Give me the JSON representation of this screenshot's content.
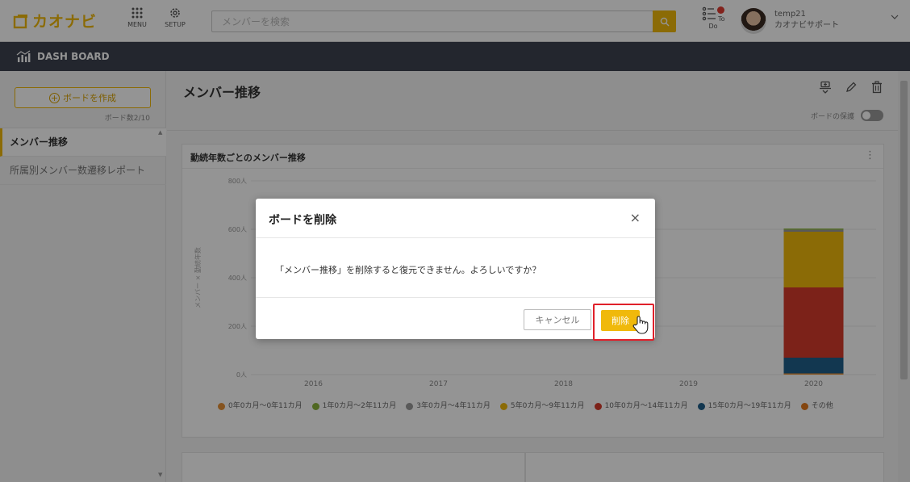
{
  "header": {
    "logo_text": "カオナビ",
    "menu_label": "MENU",
    "setup_label": "SETUP",
    "search_placeholder": "メンバーを検索",
    "todo_label": "To Do",
    "user_id": "temp21",
    "user_org": "カオナビサポート"
  },
  "dashbar": {
    "title": "DASH BOARD"
  },
  "sidebar": {
    "create_label": "ボードを作成",
    "board_count": "ボード数2/10",
    "items": [
      {
        "label": "メンバー推移",
        "active": true
      },
      {
        "label": "所属別メンバー数遷移レポート",
        "active": false
      }
    ]
  },
  "main": {
    "title": "メンバー推移",
    "protect_label": "ボードの保護",
    "card_title": "勤続年数ごとのメンバー推移"
  },
  "chart_data": {
    "type": "bar",
    "stacked": true,
    "categories": [
      "2016",
      "2017",
      "2018",
      "2019",
      "2020"
    ],
    "ylabel": "メンバー × 勤続年数",
    "ylim": [
      0,
      800
    ],
    "yticks": [
      "0人",
      "200人",
      "400人",
      "600人",
      "800人"
    ],
    "ytick_values": [
      0,
      200,
      400,
      600,
      800
    ],
    "series": [
      {
        "name": "0年0カ月〜0年11カ月",
        "color": "#e69138",
        "values": [
          0,
          0,
          0,
          0,
          5
        ]
      },
      {
        "name": "1年0カ月〜2年11カ月",
        "color": "#8bb33b",
        "values": [
          0,
          0,
          0,
          0,
          0
        ]
      },
      {
        "name": "3年0カ月〜4年11カ月",
        "color": "#999999",
        "values": [
          0,
          0,
          0,
          0,
          0
        ]
      },
      {
        "name": "5年0カ月〜9年11カ月",
        "color": "#f0b90b",
        "values": [
          0,
          0,
          0,
          0,
          0
        ]
      },
      {
        "name": "10年0カ月〜14年11カ月",
        "color": "#d63c2b",
        "values": [
          0,
          0,
          0,
          0,
          0
        ]
      },
      {
        "name": "15年0カ月〜19年11カ月",
        "color": "#1f5f8b",
        "values": [
          0,
          0,
          0,
          0,
          65
        ]
      },
      {
        "name": "その他",
        "color": "#e3791c",
        "values": [
          0,
          0,
          0,
          0,
          0
        ]
      }
    ],
    "segments_2020_top": [
      {
        "color": "#d63c2b",
        "value": 290
      },
      {
        "color": "#f0b90b",
        "value": 230
      },
      {
        "color": "#999999",
        "value": 8
      },
      {
        "color": "#8bb33b",
        "value": 5
      }
    ],
    "legend_position": "bottom"
  },
  "modal": {
    "title": "ボードを削除",
    "close": "×",
    "message": "「メンバー推移」を削除すると復元できません。よろしいですか？",
    "cancel_label": "キャンセル",
    "delete_label": "削除"
  }
}
